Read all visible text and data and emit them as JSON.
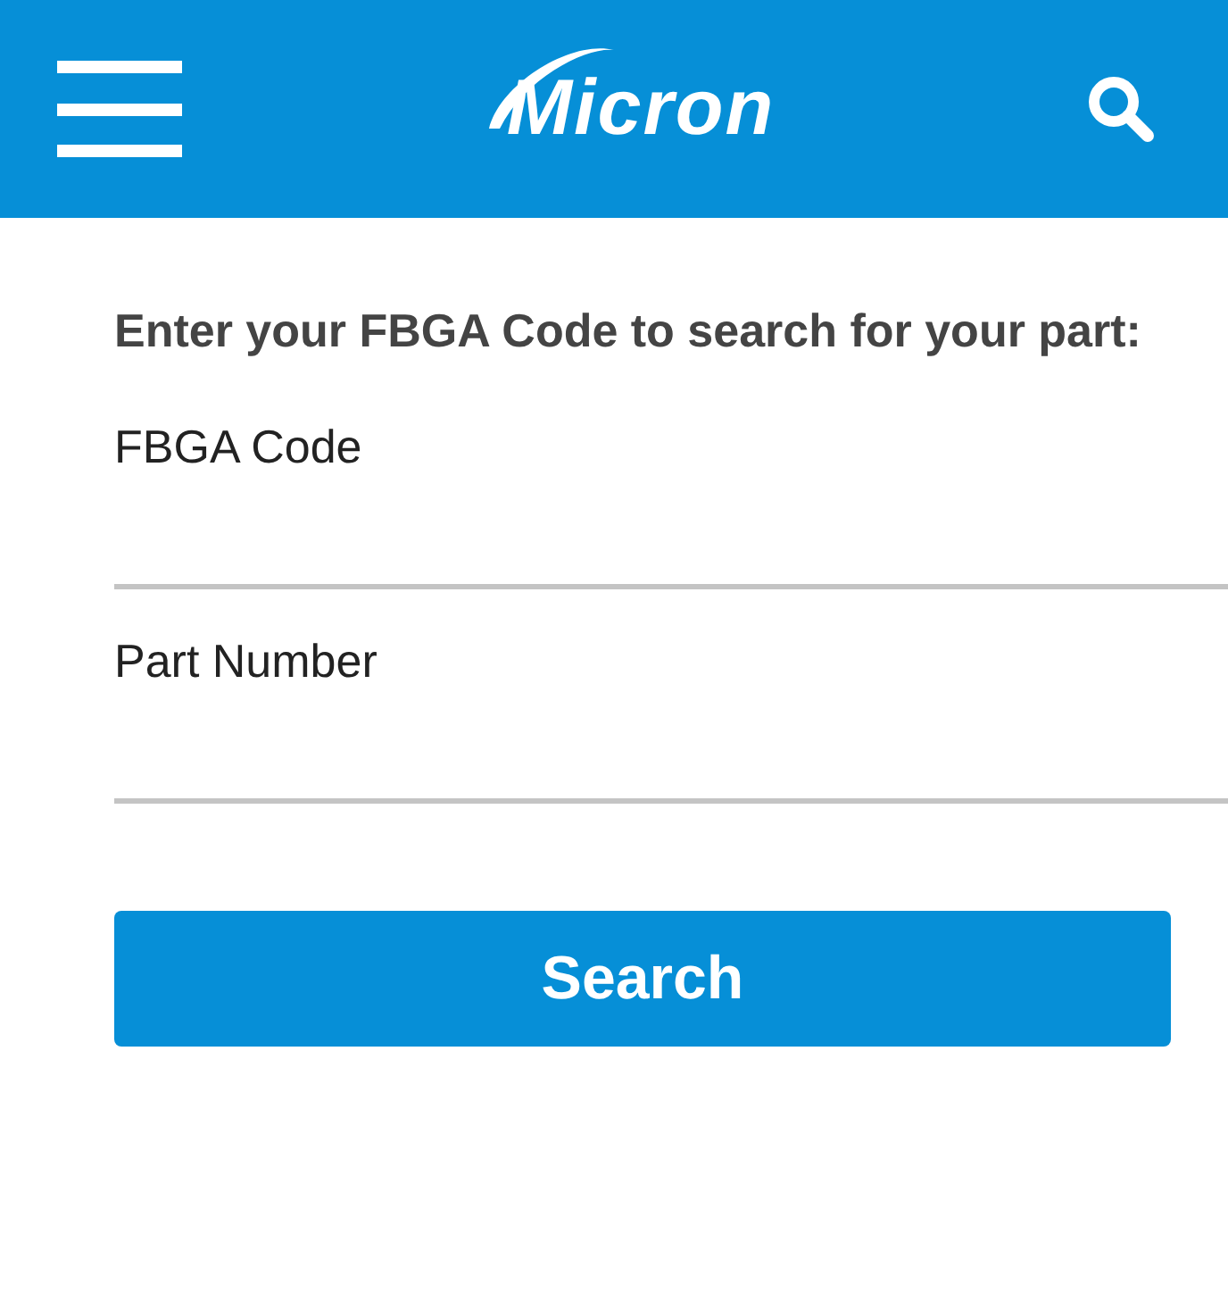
{
  "header": {
    "logo": "Micron"
  },
  "heading": "Enter your FBGA Code to search for your part:",
  "fields": [
    {
      "label": "FBGA Code"
    },
    {
      "label": "Part Number"
    }
  ],
  "button": "Search"
}
